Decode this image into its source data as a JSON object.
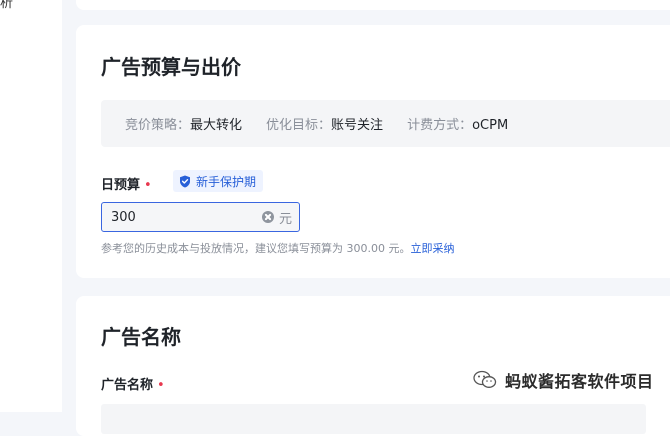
{
  "sidebar": {
    "fragment_text": "析"
  },
  "budget_section": {
    "title": "广告预算与出价",
    "info": [
      {
        "key": "竞价策略：",
        "value": "最大转化"
      },
      {
        "key": "优化目标：",
        "value": "账号关注"
      },
      {
        "key": "计费方式：",
        "value": "oCPM"
      }
    ],
    "daily_budget": {
      "label": "日预算",
      "required_mark": "•",
      "badge": "新手保护期",
      "value": "300",
      "unit": "元",
      "hint": "参考您的历史成本与投放情况，建议您填写预算为 300.00 元。",
      "hint_link": "立即采纳"
    }
  },
  "name_section": {
    "title": "广告名称",
    "field_label": "广告名称",
    "required_mark": "•"
  },
  "watermark": {
    "text": "蚂蚁酱拓客软件项目"
  },
  "colors": {
    "accent": "#2860d8",
    "required": "#e8384f",
    "border_active": "#3a66e0"
  }
}
